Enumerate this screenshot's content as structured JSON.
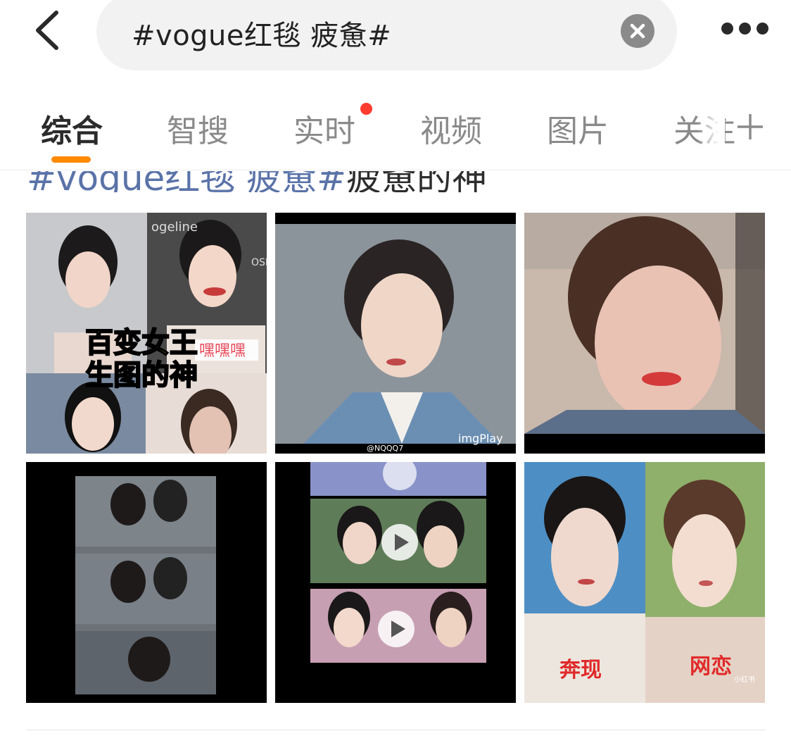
{
  "search": {
    "query": "#vogue红毯 疲惫#"
  },
  "tabs": [
    {
      "label": "综合",
      "active": true
    },
    {
      "label": "智搜"
    },
    {
      "label": "实时",
      "has_notification_dot": true
    },
    {
      "label": "视频"
    },
    {
      "label": "图片"
    },
    {
      "label": "关注"
    }
  ],
  "headline": {
    "topic": "#vogue红毯 疲惫#",
    "rest": "疲惫的神"
  },
  "images": [
    {
      "overlay_text_1": "百变女王",
      "overlay_text_2": "生图的神",
      "small_text": "嘿嘿嘿",
      "brand_text": "ogeline",
      "side_text": "OSMO"
    },
    {
      "watermark": "imgPlay",
      "credit": "@NQQQ7"
    },
    {},
    {},
    {},
    {
      "caption_left": "奔现",
      "caption_right": "网恋",
      "corner_tag": "小红书"
    }
  ],
  "colors": {
    "accent": "#ff8a00",
    "notification": "#ff3b30",
    "topic_link": "#5a73a8"
  }
}
